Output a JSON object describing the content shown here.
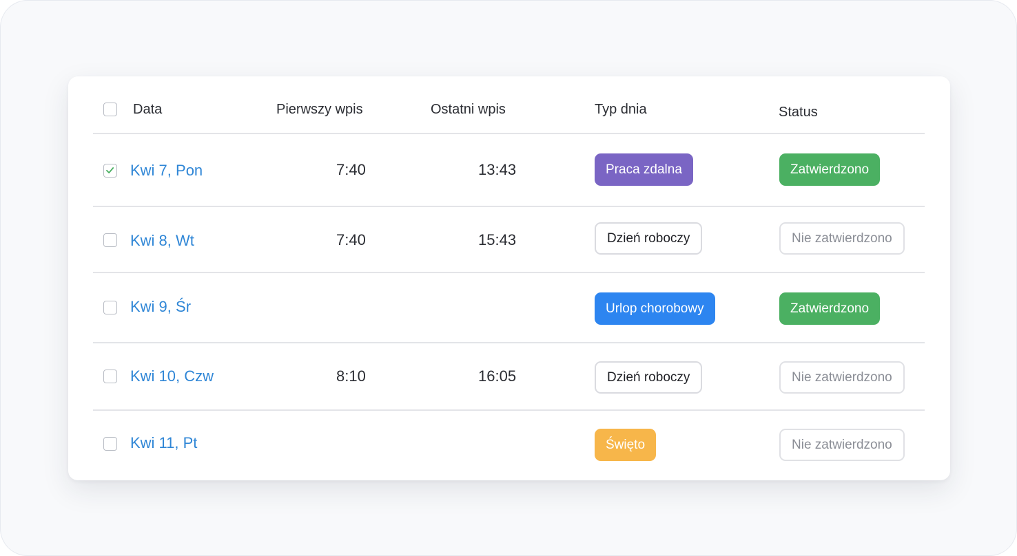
{
  "table": {
    "headers": {
      "date": "Data",
      "first_entry": "Pierwszy wpis",
      "last_entry": "Ostatni wpis",
      "day_type": "Typ dnia",
      "status": "Status"
    },
    "rows": [
      {
        "date": "Kwi 7, Pon",
        "first": "7:40",
        "last": "13:43",
        "day_type": "Praca zdalna",
        "status": "Zatwierdzono",
        "checked": true
      },
      {
        "date": "Kwi 8, Wt",
        "first": "7:40",
        "last": "15:43",
        "day_type": "Dzień roboczy",
        "status": "Nie zatwierdzono",
        "checked": false
      },
      {
        "date": "Kwi 9, Śr",
        "first": "",
        "last": "",
        "day_type": "Urlop chorobowy",
        "status": "Zatwierdzono",
        "checked": false
      },
      {
        "date": "Kwi 10, Czw",
        "first": "8:10",
        "last": "16:05",
        "day_type": "Dzień roboczy",
        "status": "Nie zatwierdzono",
        "checked": false
      },
      {
        "date": "Kwi 11, Pt",
        "first": "",
        "last": "",
        "day_type": "Święto",
        "status": "Nie zatwierdzono",
        "checked": false
      }
    ]
  },
  "colors": {
    "link": "#2f86d6",
    "remote_work": "#7a65c4",
    "sick_leave": "#2d85f0",
    "holiday": "#f7b64a",
    "approved": "#4bb062",
    "checkmark": "#4bb062"
  },
  "icons": {
    "checkbox_checked": "check-icon"
  }
}
